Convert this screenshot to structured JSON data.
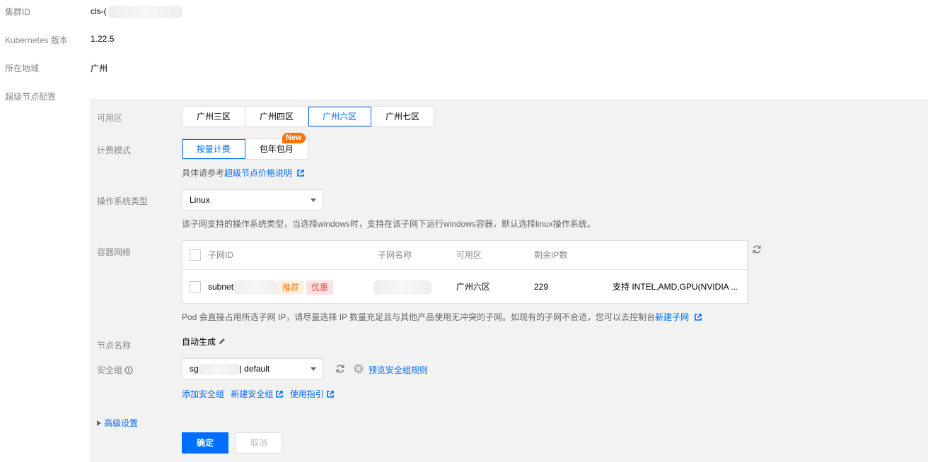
{
  "info": {
    "cluster_id_label": "集群ID",
    "cluster_id_value": "cls-(",
    "k8s_label": "Kubernetes 版本",
    "k8s_value": "1.22.5",
    "region_label": "所在地域",
    "region_value": "广州",
    "super_node_label": "超级节点配置"
  },
  "zone": {
    "label": "可用区",
    "options": [
      "广州三区",
      "广州四区",
      "广州六区",
      "广州七区"
    ],
    "selected": "广州六区"
  },
  "billing": {
    "label": "计费模式",
    "options": [
      "按量计费",
      "包年包月"
    ],
    "selected": "按量计费",
    "new_badge": "New",
    "hint_prefix": "具体请参考",
    "hint_link": "超级节点价格说明"
  },
  "os": {
    "label": "操作系统类型",
    "value": "Linux",
    "hint": "该子网支持的操作系统类型，当选择windows时，支持在该子网下运行windows容器，默认选择linux操作系统。"
  },
  "network": {
    "label": "容器网络",
    "columns": [
      "子网ID",
      "子网名称",
      "可用区",
      "剩余IP数"
    ],
    "rows": [
      {
        "subnet_id": "subnet",
        "tag_recommend": "推荐",
        "tag_discount": "优惠",
        "name": "",
        "zone": "广州六区",
        "ip_count": "229",
        "support": "支持 INTEL,AMD,GPU(NVIDIA ..."
      }
    ],
    "hint": "Pod 会直接占用所选子网 IP，请尽量选择 IP 数量充足且与其他产品使用无冲突的子网。如现有的子网不合适，您可以去控制台",
    "hint_link": "新建子网"
  },
  "node_name": {
    "label": "节点名称",
    "value": "自动生成"
  },
  "security_group": {
    "label": "安全组",
    "value_prefix": "sg",
    "value_suffix": "| default",
    "preview_link": "预览安全组规则",
    "add_link": "添加安全组",
    "new_link": "新建安全组",
    "guide_link": "使用指引"
  },
  "advanced": {
    "label": "高级设置"
  },
  "actions": {
    "confirm": "确定",
    "cancel": "取消"
  },
  "colors": {
    "accent": "#006eff",
    "badge": "#ff7200",
    "discount": "#e54545"
  }
}
